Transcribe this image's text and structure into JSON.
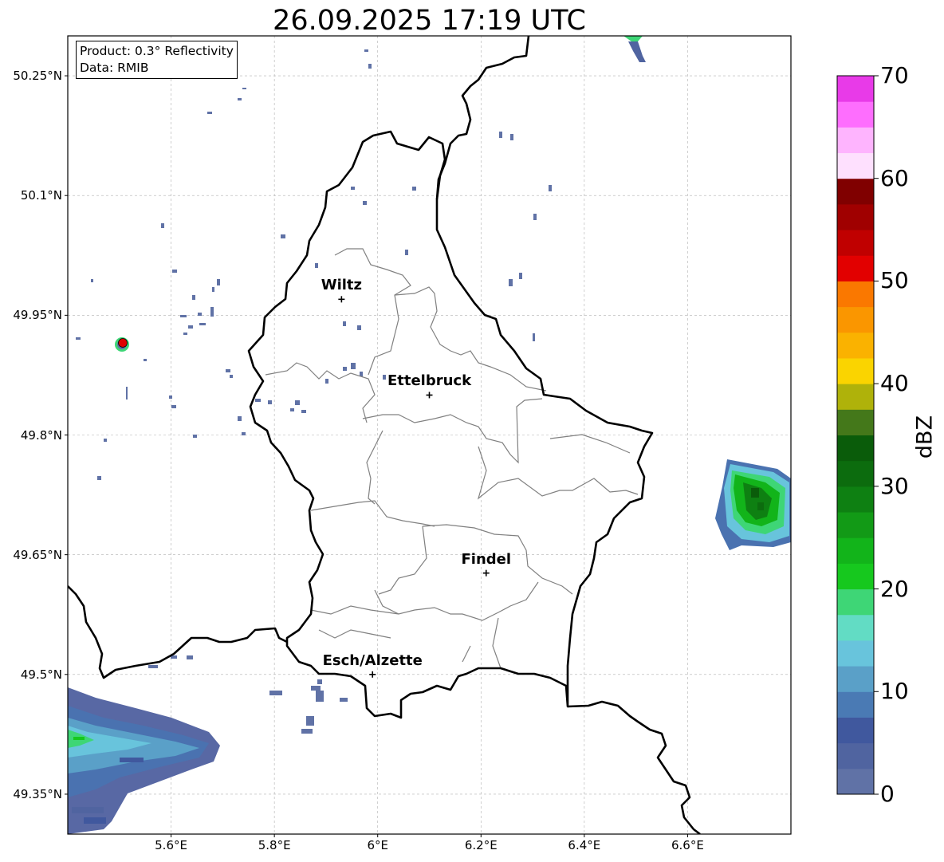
{
  "title": "26.09.2025 17:19 UTC",
  "info": {
    "product_line": "Product: 0.3° Reflectivity",
    "data_line": "Data: RMIB"
  },
  "colorbar": {
    "label": "dBZ",
    "ticks": [
      "0",
      "10",
      "20",
      "30",
      "40",
      "50",
      "60",
      "70"
    ],
    "range": [
      0,
      70
    ],
    "step": 2.5,
    "colors": [
      "#6072a6",
      "#5064a0",
      "#40589e",
      "#4a7ab4",
      "#5aa0c8",
      "#68c4dc",
      "#62dcc4",
      "#3ed676",
      "#16c81e",
      "#12b41a",
      "#129a16",
      "#0e8012",
      "#0c6c0e",
      "#0a5c0a",
      "#44781a",
      "#afb20a",
      "#fad400",
      "#fab200",
      "#fa9600",
      "#fa7800",
      "#e20000",
      "#c00000",
      "#a00000",
      "#800000",
      "#fee0fe",
      "#feb4fe",
      "#fe6efe",
      "#e83ae8"
    ]
  },
  "axes": {
    "lat_labels": [
      "50.25°N",
      "50.1°N",
      "49.95°N",
      "49.8°N",
      "49.65°N",
      "49.5°N",
      "49.35°N"
    ],
    "lon_labels": [
      "5.6°E",
      "5.8°E",
      "6°E",
      "6.2°E",
      "6.4°E",
      "6.6°E"
    ],
    "lat_values": [
      50.25,
      50.1,
      49.95,
      49.8,
      49.65,
      49.5,
      49.35
    ],
    "lon_values": [
      5.6,
      5.8,
      6.0,
      6.2,
      6.4,
      6.6
    ],
    "lon_range": [
      5.4,
      6.8
    ],
    "lat_range": [
      49.3,
      50.3
    ]
  },
  "cities": [
    {
      "name": "Wiltz",
      "lon": 5.93,
      "lat": 49.97
    },
    {
      "name": "Ettelbruck",
      "lon": 6.1,
      "lat": 49.85
    },
    {
      "name": "Findel",
      "lon": 6.21,
      "lat": 49.627
    },
    {
      "name": "Esch/Alzette",
      "lon": 5.99,
      "lat": 49.5
    }
  ],
  "radar_marker": {
    "lon": 5.505,
    "lat": 49.915,
    "color": "#e00000"
  }
}
